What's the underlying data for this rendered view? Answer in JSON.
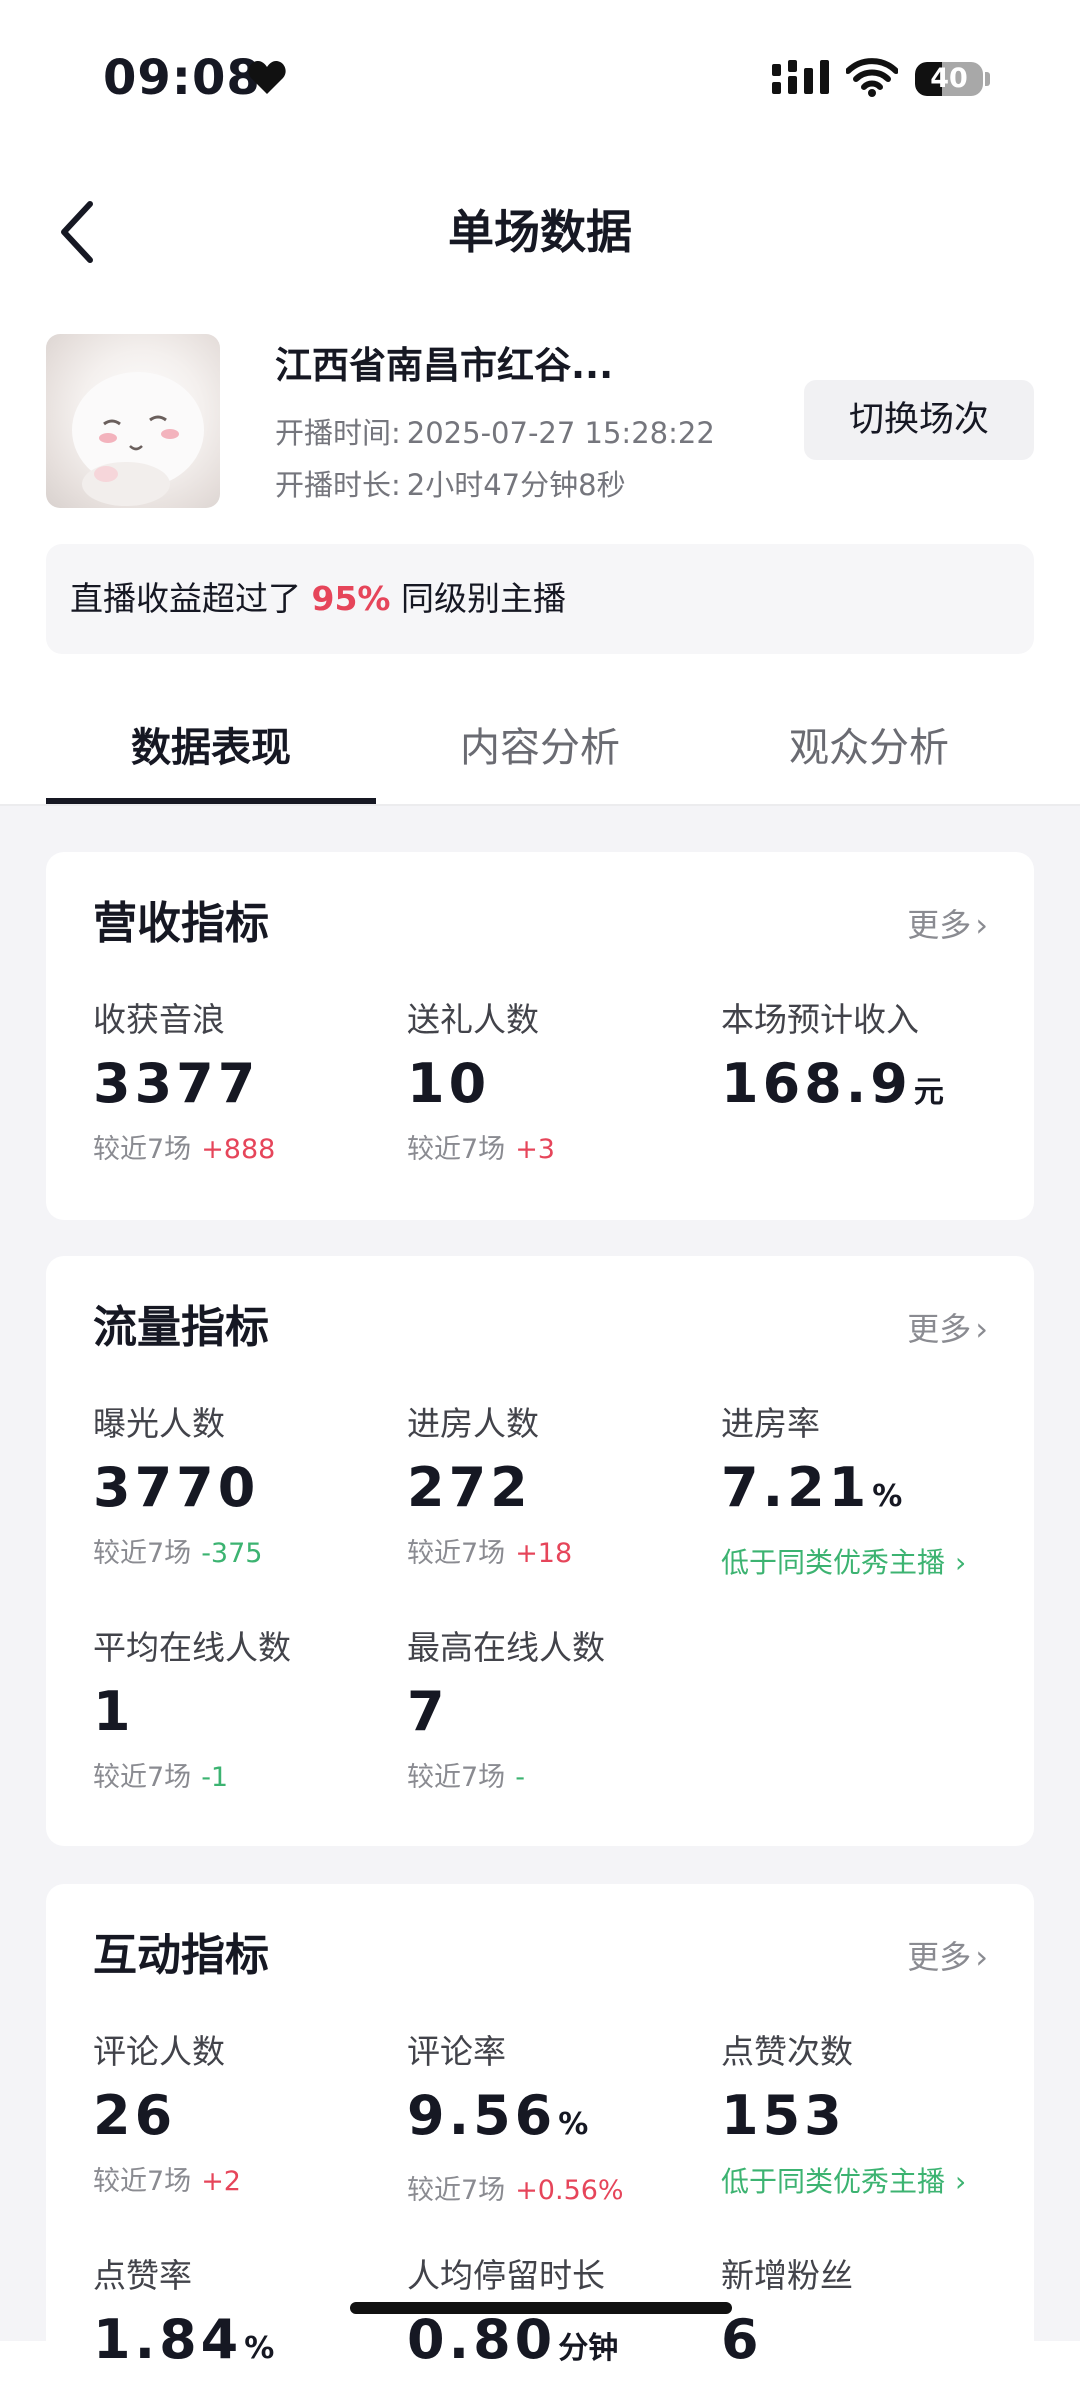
{
  "status_bar": {
    "time": "09:08",
    "battery": "40",
    "battery_level": 0.4
  },
  "header": {
    "title": "单场数据"
  },
  "room": {
    "name": "江西省南昌市红谷...",
    "start_label": "开播时间:",
    "start_value": "2025-07-27 15:28:22",
    "duration_label": "开播时长:",
    "duration_value": "2小时47分钟8秒",
    "switch_button": "切换场次"
  },
  "banner": {
    "prefix": "直播收益超过了",
    "percent": "95%",
    "suffix": "同级别主播"
  },
  "tabs": [
    "数据表现",
    "内容分析",
    "观众分析"
  ],
  "revenue": {
    "title": "营收指标",
    "more": "更多",
    "metrics": [
      {
        "label": "收获音浪",
        "value": "3377",
        "cmp_label": "较近7场",
        "cmp_value": "+888"
      },
      {
        "label": "送礼人数",
        "value": "10",
        "cmp_label": "较近7场",
        "cmp_value": "+3"
      },
      {
        "label": "本场预计收入",
        "value": "168.9",
        "unit": "元"
      }
    ]
  },
  "traffic": {
    "title": "流量指标",
    "more": "更多",
    "metrics": [
      {
        "label": "曝光人数",
        "value": "3770",
        "cmp_label": "较近7场",
        "cmp_value": "-375"
      },
      {
        "label": "进房人数",
        "value": "272",
        "cmp_label": "较近7场",
        "cmp_value": "+18"
      },
      {
        "label": "进房率",
        "value": "7.21",
        "unit": "%",
        "hint": "低于同类优秀主播"
      },
      {
        "label": "平均在线人数",
        "value": "1",
        "cmp_label": "较近7场",
        "cmp_value": "-1"
      },
      {
        "label": "最高在线人数",
        "value": "7",
        "cmp_label": "较近7场",
        "cmp_value": "-"
      }
    ]
  },
  "interaction": {
    "title": "互动指标",
    "more": "更多",
    "metrics": [
      {
        "label": "评论人数",
        "value": "26",
        "cmp_label": "较近7场",
        "cmp_value": "+2"
      },
      {
        "label": "评论率",
        "value": "9.56",
        "unit": "%",
        "cmp_label": "较近7场",
        "cmp_value": "+0.56%"
      },
      {
        "label": "点赞次数",
        "value": "153",
        "hint": "低于同类优秀主播"
      },
      {
        "label": "点赞率",
        "value": "1.84",
        "unit": "%"
      },
      {
        "label": "人均停留时长",
        "value": "0.80",
        "unit": "分钟"
      },
      {
        "label": "新增粉丝",
        "value": "6"
      }
    ]
  },
  "colors": {
    "positive": "#e6455a",
    "negative": "#3cb371",
    "text": "#161823",
    "muted": "#8a8b91",
    "background": "#f4f4f7"
  }
}
